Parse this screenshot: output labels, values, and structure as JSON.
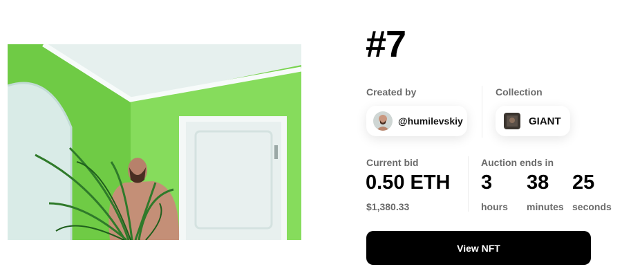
{
  "nft": {
    "title": "#7",
    "created_by_label": "Created by",
    "creator_handle": "@humilevskiy",
    "collection_label": "Collection",
    "collection_name": "GIANT",
    "current_bid_label": "Current bid",
    "current_bid": "0.50 ETH",
    "current_bid_usd": "$1,380.33",
    "auction_label": "Auction ends in",
    "countdown": {
      "hours": "3",
      "hours_label": "hours",
      "minutes": "38",
      "minutes_label": "minutes",
      "seconds": "25",
      "seconds_label": "seconds"
    },
    "view_button": "View NFT"
  },
  "colors": {
    "wall_green": "#7ed957",
    "button_bg": "#000000",
    "muted_text": "#6b6b6b"
  }
}
